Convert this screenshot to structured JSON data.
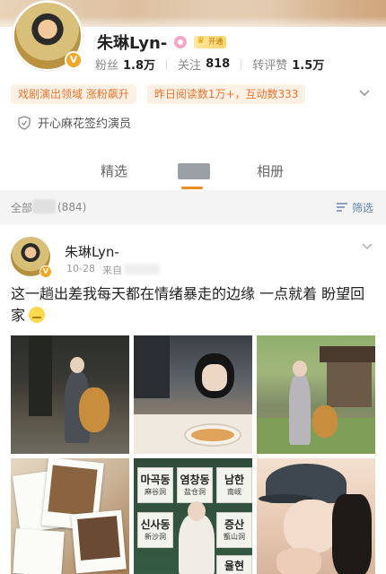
{
  "profile": {
    "name": "朱琳Lyn-",
    "level_badge": "开通",
    "verified_mark": "V",
    "stats": [
      {
        "label": "粉丝",
        "value": "1.8万"
      },
      {
        "label": "关注",
        "value": "818"
      },
      {
        "label": "转评赞",
        "value": "1.5万"
      }
    ],
    "pills": [
      "戏剧演出领域 涨粉飙升",
      "昨日阅读数1万+，互动数333"
    ],
    "signed": "开心麻花签约演员"
  },
  "tabs": {
    "featured": "精选",
    "album": "相册"
  },
  "filter": {
    "all": "全部",
    "count": "(884)",
    "filter_label": "筛选"
  },
  "post": {
    "author": "朱琳Lyn-",
    "date": "10-28",
    "source_prefix": "来自",
    "text": "这一趟出差我每天都在情绪暴走的边缘 一点就着 盼望回家",
    "signs": {
      "s1_kr": "마곡동",
      "s1_cn": "麻谷洞",
      "s2_kr": "염창동",
      "s2_cn": "盐仓洞",
      "s3_kr": "남한",
      "s3_cn": "南岘",
      "s4_kr": "신사동",
      "s4_cn": "新沙洞",
      "s5_kr": "증산",
      "s5_cn": "甑山洞",
      "s6_kr": "율현",
      "s6_cn": "栗岘"
    }
  },
  "colors": {
    "accent_orange": "#f08a24",
    "pill_text": "#f0742a",
    "link_blue": "#5b7fb0",
    "verified_gold": "#f5a623"
  },
  "icons": {
    "verified": "v-badge-icon",
    "tag": "pink-tag-icon",
    "shield": "shield-icon",
    "chevron": "chevron-down-icon",
    "filter": "filter-icon",
    "emoji": "rolling-eyes-emoji-icon"
  }
}
